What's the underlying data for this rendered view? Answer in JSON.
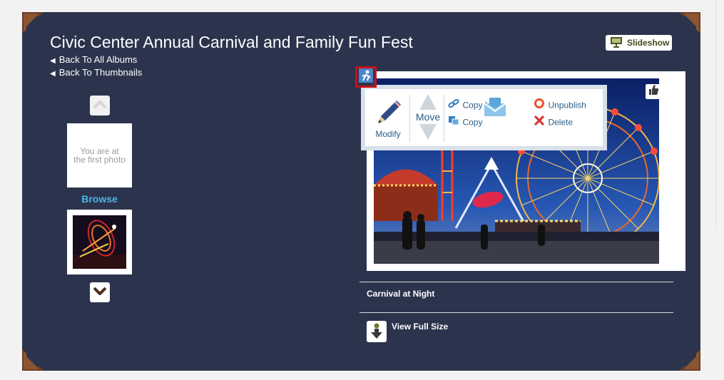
{
  "album": {
    "title": "Civic Center Annual Carnival and Family Fun Fest",
    "back_albums": "Back To All Albums",
    "back_thumbnails": "Back To Thumbnails",
    "slideshow_label": "Slideshow"
  },
  "sidebar": {
    "first_photo_text": "You are at the first photo",
    "browse_label": "Browse"
  },
  "edit_menu": {
    "modify": "Modify",
    "move": "Move",
    "copy_link": "Copy Link",
    "copy": "Copy",
    "unpublish": "Unpublish",
    "delete": "Delete"
  },
  "photo": {
    "caption": "Carnival at Night",
    "view_full_size": "View Full Size"
  },
  "icons": {
    "slideshow": "projector-icon",
    "up": "chevron-up-icon",
    "down": "chevron-down-icon",
    "edit": "edit-person-icon",
    "like": "thumbs-up-icon",
    "modify": "pencil-icon",
    "copy_link": "link-icon",
    "copy": "copy-icon",
    "unpublish": "unpublish-icon",
    "delete": "delete-x-icon",
    "download": "download-icon"
  },
  "colors": {
    "album_bg": "#2c344d",
    "accent_link": "#4bb4e8",
    "menu_text": "#2b5d86",
    "highlight": "#c5111b"
  }
}
